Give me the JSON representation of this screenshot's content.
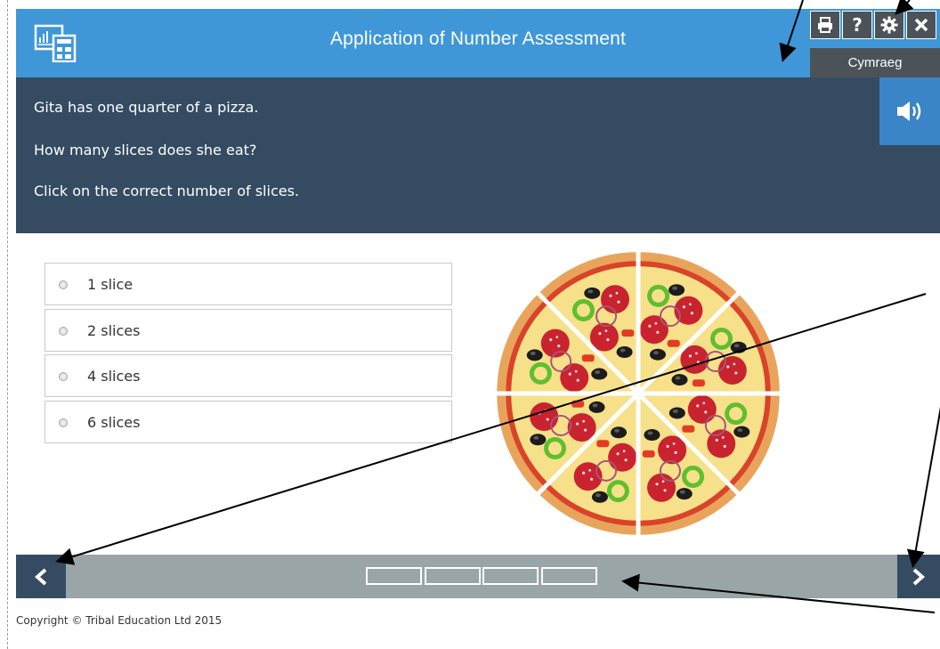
{
  "header": {
    "title": "Application of Number Assessment",
    "logo_icon": "calculator-chart-icon",
    "toolbar": [
      {
        "name": "print",
        "icon": "print-icon"
      },
      {
        "name": "help",
        "icon": "help-icon",
        "glyph": "?"
      },
      {
        "name": "settings",
        "icon": "gear-icon"
      },
      {
        "name": "close",
        "icon": "close-icon"
      }
    ],
    "language_label": "Cymraeg"
  },
  "question": {
    "lines": [
      "Gita has one quarter of a pizza.",
      "How many slices does she eat?",
      "Click on the correct number of slices."
    ],
    "audio_icon": "speaker-icon"
  },
  "options": [
    {
      "label": "1 slice",
      "selected": false
    },
    {
      "label": "2 slices",
      "selected": false
    },
    {
      "label": "4 slices",
      "selected": false
    },
    {
      "label": "6 slices",
      "selected": false
    }
  ],
  "pizza": {
    "slices": 8,
    "image_icon": "pizza-image"
  },
  "navigation": {
    "prev_icon": "chevron-left-icon",
    "next_icon": "chevron-right-icon",
    "progress_segments": 4,
    "progress_current": 0
  },
  "footer": {
    "copyright": "Copyright © Tribal Education Ltd 2015"
  },
  "colors": {
    "header_blue": "#3f97d8",
    "panel_navy": "#344b62",
    "toolbar_gray": "#4b5358",
    "nav_gray": "#99a5a6",
    "audio_blue": "#3b84c8"
  }
}
